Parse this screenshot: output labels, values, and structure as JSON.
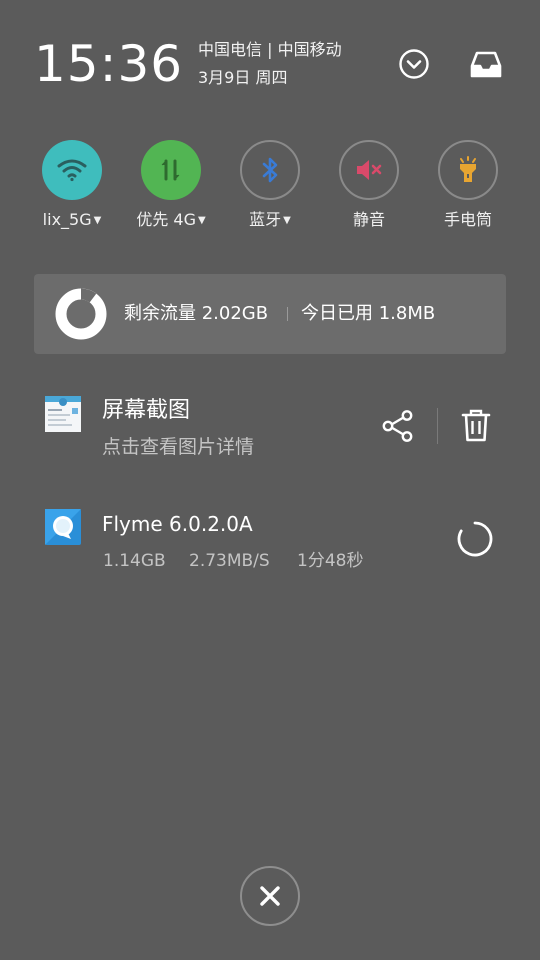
{
  "header": {
    "time": "15:36",
    "carrier": "中国电信 | 中国移动",
    "date": "3月9日 周四"
  },
  "toggles": [
    {
      "label": "lix_5G",
      "caret": "▼",
      "state": "on",
      "icon": "wifi-icon",
      "color": "#3fbdbd"
    },
    {
      "label": "优先 4G",
      "caret": "▼",
      "state": "on",
      "icon": "mobile-data-icon",
      "color": "#52b553"
    },
    {
      "label": "蓝牙",
      "caret": "▼",
      "state": "off",
      "icon": "bluetooth-icon",
      "color": "#3a7bd5"
    },
    {
      "label": "静音",
      "caret": "",
      "state": "off",
      "icon": "mute-icon",
      "color": "#d94a6a"
    },
    {
      "label": "手电筒",
      "caret": "",
      "state": "off",
      "icon": "flashlight-icon",
      "color": "#e8a531"
    }
  ],
  "data_usage": {
    "remaining": "剩余流量 2.02GB",
    "today": "今日已用 1.8MB"
  },
  "notifications": [
    {
      "title": "屏幕截图",
      "subtitle": "点击查看图片详情",
      "icon": "screenshot-thumbnail"
    },
    {
      "title": "Flyme 6.0.2.0A",
      "size": "1.14GB",
      "speed": "2.73MB/S",
      "remaining_time": "1分48秒",
      "icon": "flyme-icon"
    }
  ]
}
